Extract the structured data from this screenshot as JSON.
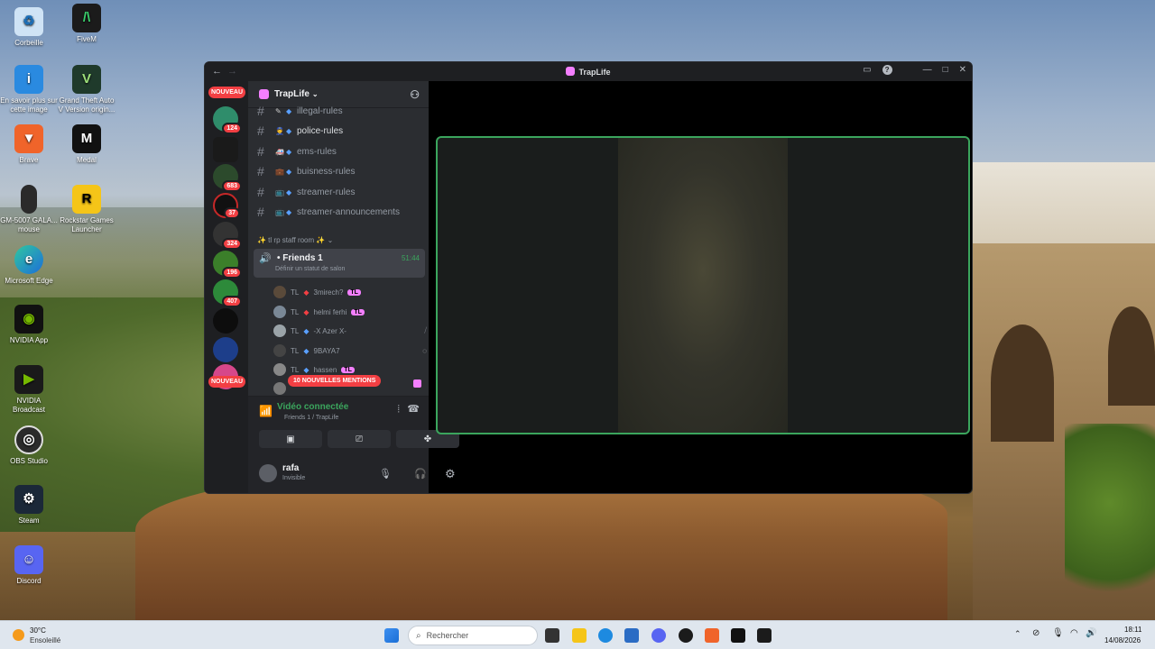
{
  "desktop": {
    "icons": [
      {
        "label": "Corbeille"
      },
      {
        "label": "FiveM"
      },
      {
        "label": "En savoir plus sur cette image"
      },
      {
        "label": "Grand Theft Auto V Version origin..."
      },
      {
        "label": "Brave"
      },
      {
        "label": "Medal"
      },
      {
        "label": "GM-5007 GALA... mouse"
      },
      {
        "label": "Rockstar Games Launcher"
      },
      {
        "label": "Microsoft Edge"
      },
      {
        "label": "NVIDIA App"
      },
      {
        "label": "NVIDIA Broadcast"
      },
      {
        "label": "OBS Studio"
      },
      {
        "label": "Steam"
      },
      {
        "label": "Discord"
      }
    ]
  },
  "window": {
    "title": "TrapLife",
    "back": "←",
    "forward": "→"
  },
  "guilds": {
    "top_badge": "NOUVEAU",
    "bottom_badge": "NOUVEAU",
    "badges": [
      "124",
      "683",
      "37",
      "324",
      "196",
      "407"
    ]
  },
  "server": {
    "name": "TrapLife",
    "channels": [
      {
        "name": "illegal-rules"
      },
      {
        "name": "police-rules"
      },
      {
        "name": "ems-rules"
      },
      {
        "name": "buisness-rules"
      },
      {
        "name": "streamer-rules"
      },
      {
        "name": "streamer-announcements"
      }
    ],
    "category": "✨ tl rp staff room ✨",
    "voice_channel": {
      "name": "Friends 1",
      "timer": "51:44",
      "status_hint": "Définir un statut de salon"
    },
    "members": [
      {
        "prefix": "TL",
        "name": "3mirech?",
        "tag": "TL"
      },
      {
        "prefix": "TL",
        "name": "helmi ferhi",
        "tag": "TL"
      },
      {
        "prefix": "TL",
        "name": "-X Azer X-",
        "tag": ""
      },
      {
        "prefix": "TL",
        "name": "9BAYA7",
        "tag": ""
      },
      {
        "prefix": "TL",
        "name": "hassen",
        "tag": "TL"
      }
    ],
    "mentions_pill": "10 NOUVELLES MENTIONS"
  },
  "rtc": {
    "status": "Vidéo connectée",
    "location": "Friends 1 / TrapLife"
  },
  "user": {
    "name": "rafa",
    "status": "Invisible"
  },
  "taskbar": {
    "weather_temp": "30°C",
    "weather_desc": "Ensoleillé",
    "search_placeholder": "Rechercher",
    "time": "18:11",
    "date": "14/08/2026"
  },
  "colors": {
    "accent_green": "#3ba55d",
    "alert_red": "#f23f43",
    "tag_pink": "#f47fff"
  }
}
